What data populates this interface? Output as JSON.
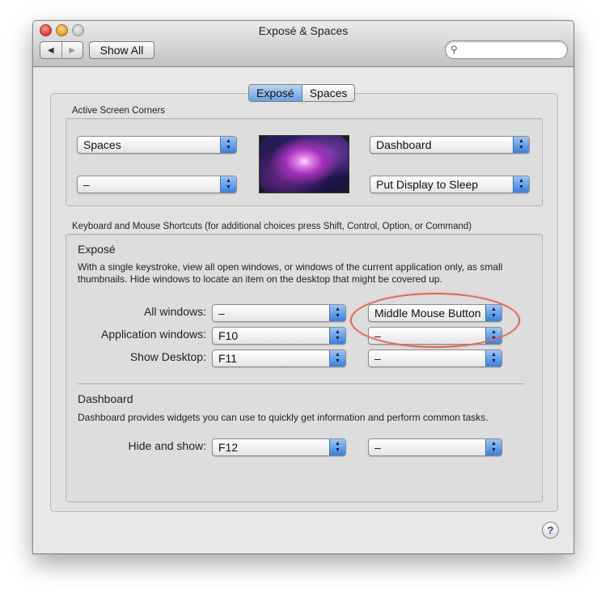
{
  "window": {
    "title": "Exposé & Spaces"
  },
  "toolbar": {
    "back_icon": "◀",
    "forward_icon": "▶",
    "show_all_label": "Show All",
    "search_icon": "⚲",
    "search_value": "",
    "search_placeholder": ""
  },
  "tabs": [
    {
      "label": "Exposé",
      "active": true
    },
    {
      "label": "Spaces",
      "active": false
    }
  ],
  "active_corners": {
    "section_label": "Active Screen Corners",
    "top_left": "Spaces",
    "bottom_left": "–",
    "top_right": "Dashboard",
    "bottom_right": "Put Display to Sleep"
  },
  "shortcuts": {
    "section_label": "Keyboard and Mouse Shortcuts (for additional choices press Shift, Control, Option, or Command)",
    "expose": {
      "title": "Exposé",
      "description_line1": "With a single keystroke, view all open windows, or windows of the current application only, as small",
      "description_line2": "thumbnails. Hide windows to locate an item on the desktop that might be covered up.",
      "rows": [
        {
          "label": "All windows:",
          "keyboard": "–",
          "mouse": "Middle Mouse Button"
        },
        {
          "label": "Application windows:",
          "keyboard": "F10",
          "mouse": "–"
        },
        {
          "label": "Show Desktop:",
          "keyboard": "F11",
          "mouse": "–"
        }
      ]
    },
    "dashboard": {
      "title": "Dashboard",
      "description": "Dashboard provides widgets you can use to quickly get information and perform common tasks.",
      "rows": [
        {
          "label": "Hide and show:",
          "keyboard": "F12",
          "mouse": "–"
        }
      ]
    }
  },
  "help": {
    "label": "?"
  },
  "colors": {
    "accent": "#3b7fdc",
    "highlight_ring": "#e06852"
  }
}
